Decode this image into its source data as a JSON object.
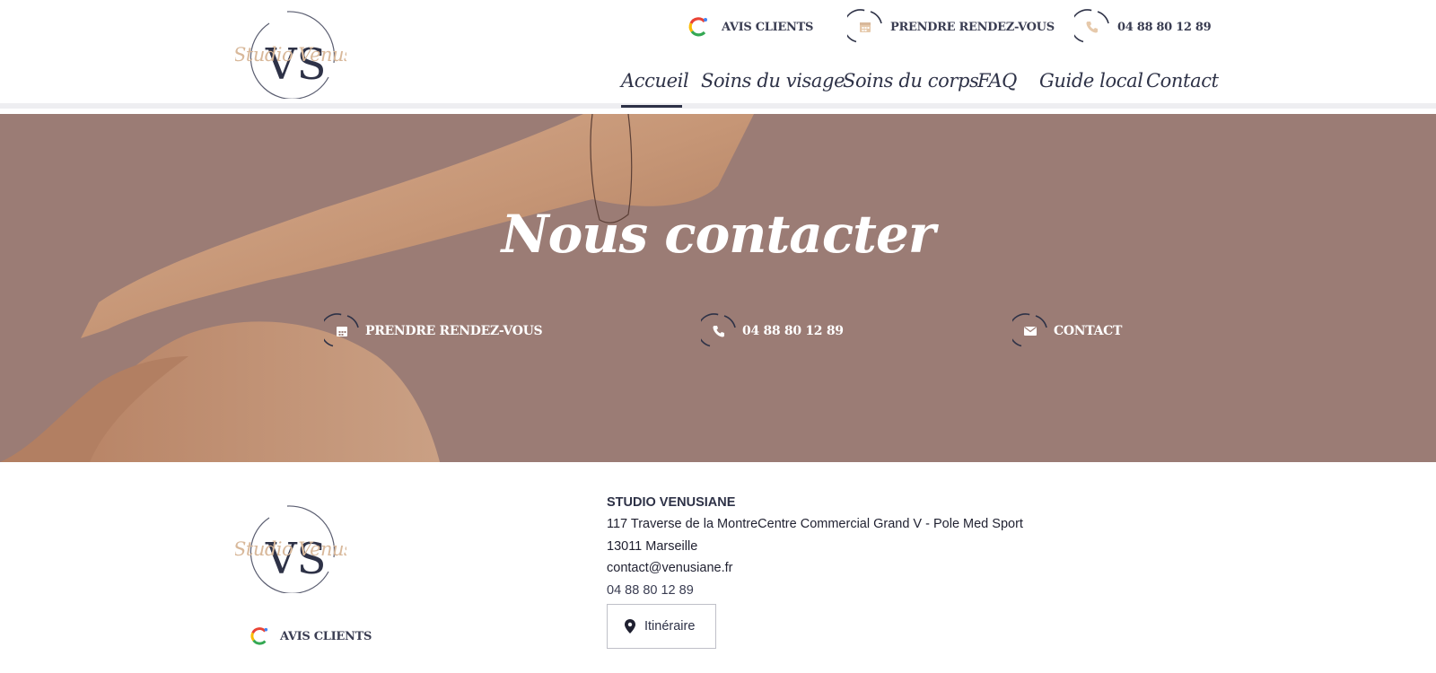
{
  "brand": {
    "logo_script": "Studio Venusiane",
    "logo_monogram": "VS"
  },
  "topbar": {
    "reviews_label": "AVIS CLIENTS",
    "appointment_label": "PRENDRE RENDEZ-VOUS",
    "phone_label": "04 88 80 12 89"
  },
  "nav": {
    "items": [
      {
        "label": "Accueil",
        "active": true
      },
      {
        "label": "Soins du visage"
      },
      {
        "label": "Soins du corps"
      },
      {
        "label": "FAQ"
      },
      {
        "label": "Guide local"
      },
      {
        "label": "Contact"
      }
    ]
  },
  "hero": {
    "title": "Nous contacter",
    "links": [
      {
        "label": "PRENDRE RENDEZ-VOUS",
        "icon": "calendar-icon"
      },
      {
        "label": "04 88 80 12 89",
        "icon": "phone-icon"
      },
      {
        "label": "CONTACT",
        "icon": "mail-icon"
      }
    ]
  },
  "footer": {
    "company_name": "STUDIO VENUSIANE",
    "address_line": "117 Traverse de la MontreCentre Commercial Grand V - Pole Med Sport",
    "city_line": "13011 Marseille",
    "email": "contact@venusiane.fr",
    "phone": "04 88 80 12 89",
    "itinerary_label": "Itinéraire",
    "reviews_label": "AVIS CLIENTS"
  },
  "colors": {
    "navy": "#2e3247",
    "gold": "#d8b89a",
    "hero_bg": "#9b7c75",
    "skin": "#c99a7c"
  }
}
